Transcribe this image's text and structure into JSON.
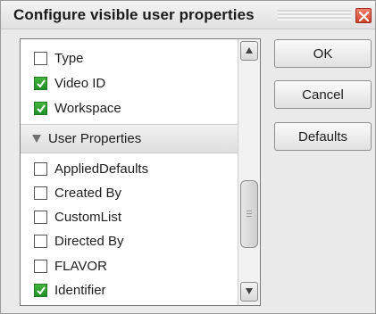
{
  "window": {
    "title": "Configure visible user properties",
    "close_icon": "close-icon"
  },
  "list": {
    "top_items": [
      {
        "label": "Type",
        "checked": false
      },
      {
        "label": "Video ID",
        "checked": true
      },
      {
        "label": "Workspace",
        "checked": true
      }
    ],
    "group": {
      "label": "User Properties",
      "expanded": true
    },
    "group_items": [
      {
        "label": "AppliedDefaults",
        "checked": false
      },
      {
        "label": "Created By",
        "checked": false
      },
      {
        "label": "CustomList",
        "checked": false
      },
      {
        "label": "Directed By",
        "checked": false
      },
      {
        "label": "FLAVOR",
        "checked": false
      },
      {
        "label": "Identifier",
        "checked": true
      }
    ]
  },
  "buttons": {
    "ok": "OK",
    "cancel": "Cancel",
    "defaults": "Defaults"
  },
  "colors": {
    "check_green": "#2fa435",
    "close_red": "#d3402a"
  }
}
